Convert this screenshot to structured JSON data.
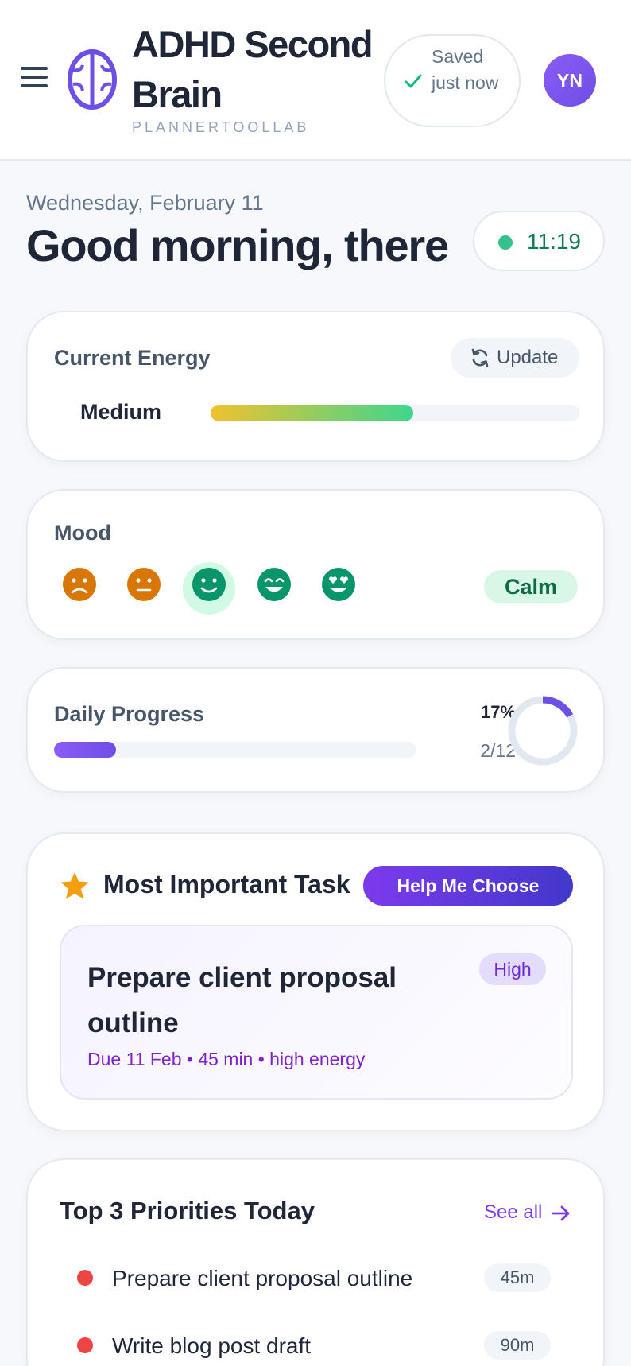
{
  "header": {
    "app_title": "ADHD Second Brain",
    "app_subtitle": "PLANNERTOOLLAB",
    "saved_status": "Saved just now",
    "avatar_initials": "YN"
  },
  "greeting": {
    "date": "Wednesday, February 11",
    "message": "Good morning, there",
    "time": "11:19"
  },
  "energy": {
    "title": "Current Energy",
    "update_label": "Update",
    "level": "Medium",
    "fill_fraction": 0.55
  },
  "mood": {
    "title": "Mood",
    "faces": [
      "sad-face-icon",
      "neutral-face-icon",
      "smile-face-icon",
      "grin-face-icon",
      "heart-eyes-face-icon"
    ],
    "selected_index": 2,
    "label": "Calm"
  },
  "progress": {
    "title": "Daily Progress",
    "percent_label": "17%",
    "count_label": "2/12",
    "fraction": 0.17
  },
  "mit": {
    "title": "Most Important Task",
    "help_label": "Help Me Choose",
    "task_title": "Prepare client proposal outline",
    "priority": "High",
    "meta": "Due 11 Feb • 45 min • high energy"
  },
  "priorities": {
    "title": "Top 3 Priorities Today",
    "see_all_label": "See all",
    "items": [
      {
        "label": "Prepare client proposal outline",
        "duration": "45m"
      },
      {
        "label": "Write blog post draft",
        "duration": "90m"
      }
    ]
  },
  "colors": {
    "accent": "#7c3aed",
    "accent_dark": "#4338ca",
    "success": "#0f7a52",
    "priority_high": "#ef4444",
    "mood_warm": "#d97706",
    "mood_green": "#079669"
  }
}
